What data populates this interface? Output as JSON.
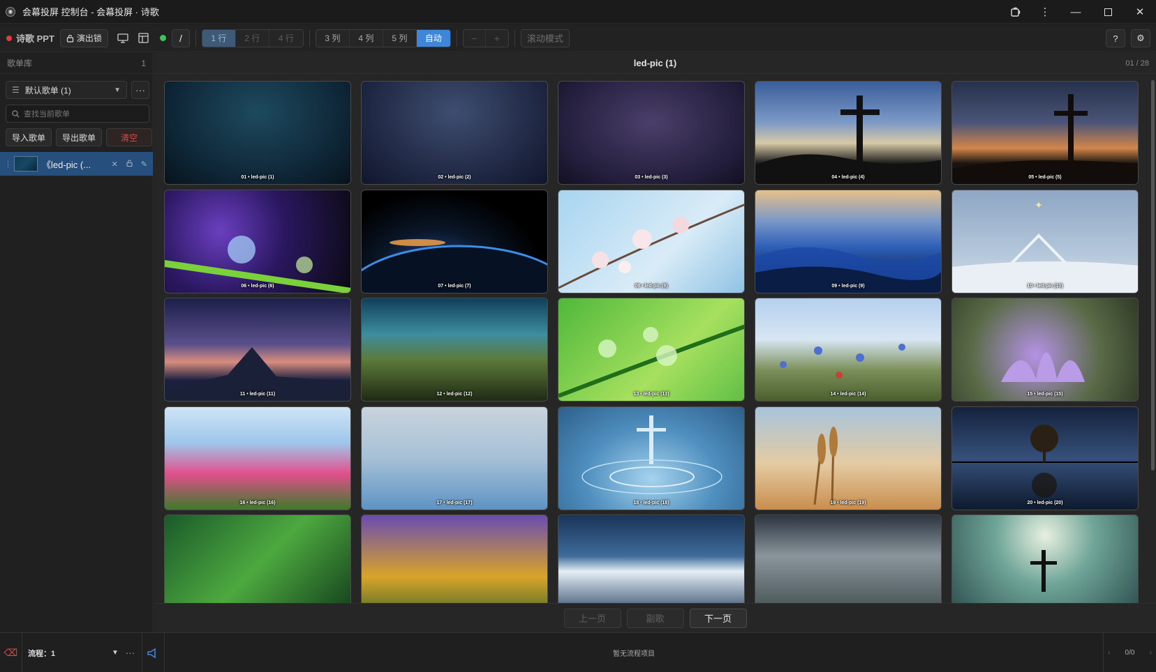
{
  "window": {
    "title": "会幕投屏 控制台 - 会幕投屏 · 诗歌"
  },
  "toolbar": {
    "app_name": "诗歌 PPT",
    "lock_label": "演出锁",
    "slash_label": "/",
    "rows": [
      "1 行",
      "2 行",
      "4 行"
    ],
    "cols": [
      "3 列",
      "4 列",
      "5 列",
      "自动"
    ],
    "zoom": [
      "−",
      "+"
    ],
    "scroll_mode": "滚动模式",
    "help_label": "?",
    "accent_color": "#3d86d9",
    "status_color": "#3cc35a"
  },
  "sidebar": {
    "header": "歌单库",
    "header_count": "1",
    "playlist_selected": "默认歌单 (1)",
    "search_placeholder": "查找当前歌单",
    "import_label": "导入歌单",
    "export_label": "导出歌单",
    "clear_label": "清空",
    "songs": [
      {
        "title": "《led-pic (..."
      }
    ]
  },
  "main": {
    "title": "led-pic (1)",
    "page_count": "01 / 28",
    "tiles": [
      "01 • led-pic (1)",
      "02 • led-pic (2)",
      "03 • led-pic (3)",
      "04 • led-pic (4)",
      "05 • led-pic (5)",
      "06 • led-pic (6)",
      "07 • led-pic (7)",
      "08 • led-pic (8)",
      "09 • led-pic (9)",
      "10 • led-pic (10)",
      "11 • led-pic (11)",
      "12 • led-pic (12)",
      "13 • led-pic (13)",
      "14 • led-pic (14)",
      "15 • led-pic (15)",
      "16 • led-pic (16)",
      "17 • led-pic (17)",
      "18 • led-pic (18)",
      "19 • led-pic (19)",
      "20 • led-pic (20)",
      "",
      "",
      "",
      "",
      ""
    ]
  },
  "pager": {
    "prev_label": "上一页",
    "chorus_label": "副歌",
    "next_label": "下一页"
  },
  "bottom": {
    "flow_label": "流程：1",
    "empty_text": "暂无流程项目",
    "count": "0/0"
  }
}
